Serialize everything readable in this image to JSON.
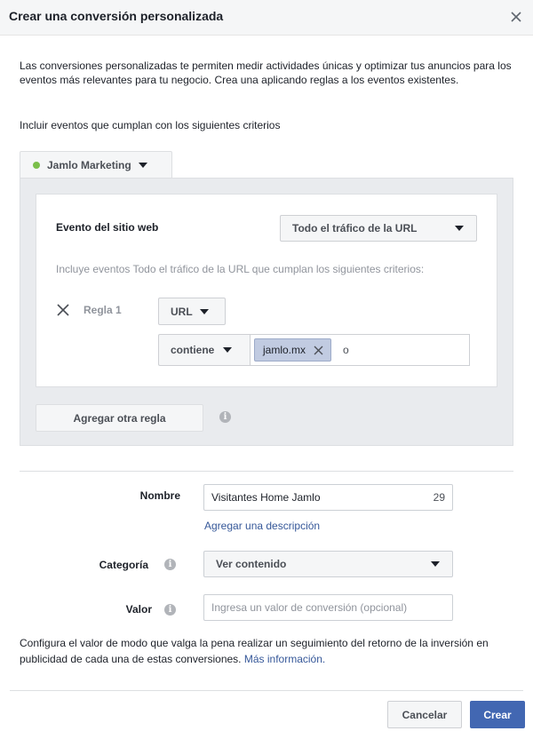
{
  "header": {
    "title": "Crear una conversión personalizada",
    "close_icon": "close-icon"
  },
  "intro": {
    "text": "Las conversiones personalizadas te permiten medir actividades únicas y optimizar tus anuncios para los eventos más relevantes para tu negocio. Crea una aplicando reglas a los eventos existentes.",
    "criteria_label": "Incluir eventos que cumplan con los siguientes criterios"
  },
  "source": {
    "label": "Jamlo Marketing",
    "status_color": "#7bbf4a"
  },
  "event": {
    "label": "Evento del sitio web",
    "selected": "Todo el tráfico de la URL",
    "rule_info": "Incluye eventos Todo el tráfico de la URL que cumplan los siguientes criterios:"
  },
  "rule": {
    "label": "Regla 1",
    "field": "URL",
    "operator": "contiene",
    "tokens": [
      "jamlo.mx"
    ],
    "typed": "o"
  },
  "add_rule_label": "Agregar otra regla",
  "form": {
    "name_label": "Nombre",
    "name_value": "Visitantes Home Jamlo",
    "name_count": "29",
    "add_description": "Agregar una descripción",
    "category_label": "Categoría",
    "category_value": "Ver contenido",
    "value_label": "Valor",
    "value_placeholder": "Ingresa un valor de conversión (opcional)"
  },
  "footnote": {
    "text": "Configura el valor de modo que valga la pena realizar un seguimiento del retorno de la inversión en publicidad de cada una de estas conversiones. ",
    "more_link": "Más información."
  },
  "footer": {
    "cancel_label": "Cancelar",
    "create_label": "Crear",
    "primary_color": "#4267b2"
  }
}
